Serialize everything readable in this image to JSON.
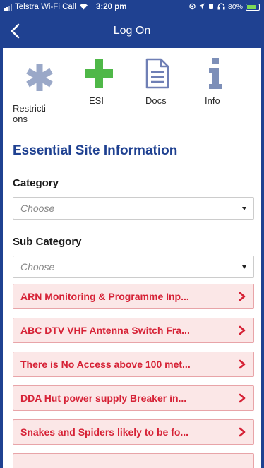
{
  "status_bar": {
    "carrier": "Telstra Wi-Fi Call",
    "time": "3:20 pm",
    "battery_percent": "80%",
    "battery_level": 0.8,
    "icons": [
      "signal-icon",
      "wifi-icon",
      "location-icon",
      "alarm-icon",
      "headphones-icon",
      "battery-icon"
    ]
  },
  "nav": {
    "title": "Log On",
    "back_icon": "chevron-left-icon"
  },
  "toolbar": {
    "restrictions_label": "Restricti\nons",
    "esi_label": "ESI",
    "docs_label": "Docs",
    "info_label": "Info"
  },
  "section_title": "Essential Site Information",
  "category": {
    "label": "Category",
    "placeholder": "Choose"
  },
  "sub_category": {
    "label": "Sub Category",
    "placeholder": "Choose"
  },
  "esi_items": [
    "ARN Monitoring & Programme Inp...",
    "ABC DTV VHF Antenna Switch Fra...",
    "There is No Access above 100 met...",
    "DDA Hut power supply Breaker in...",
    "Snakes and Spiders likely to be fo..."
  ],
  "colors": {
    "brand": "#1f4191",
    "restrictions_icon": "#9aa8c8",
    "esi_icon": "#4fb848",
    "docs_icon": "#6f7fb5",
    "info_icon": "#7d8fb8",
    "alert_text": "#d62236",
    "alert_bg": "#fbe7e7",
    "alert_border": "#e8a4a8"
  }
}
